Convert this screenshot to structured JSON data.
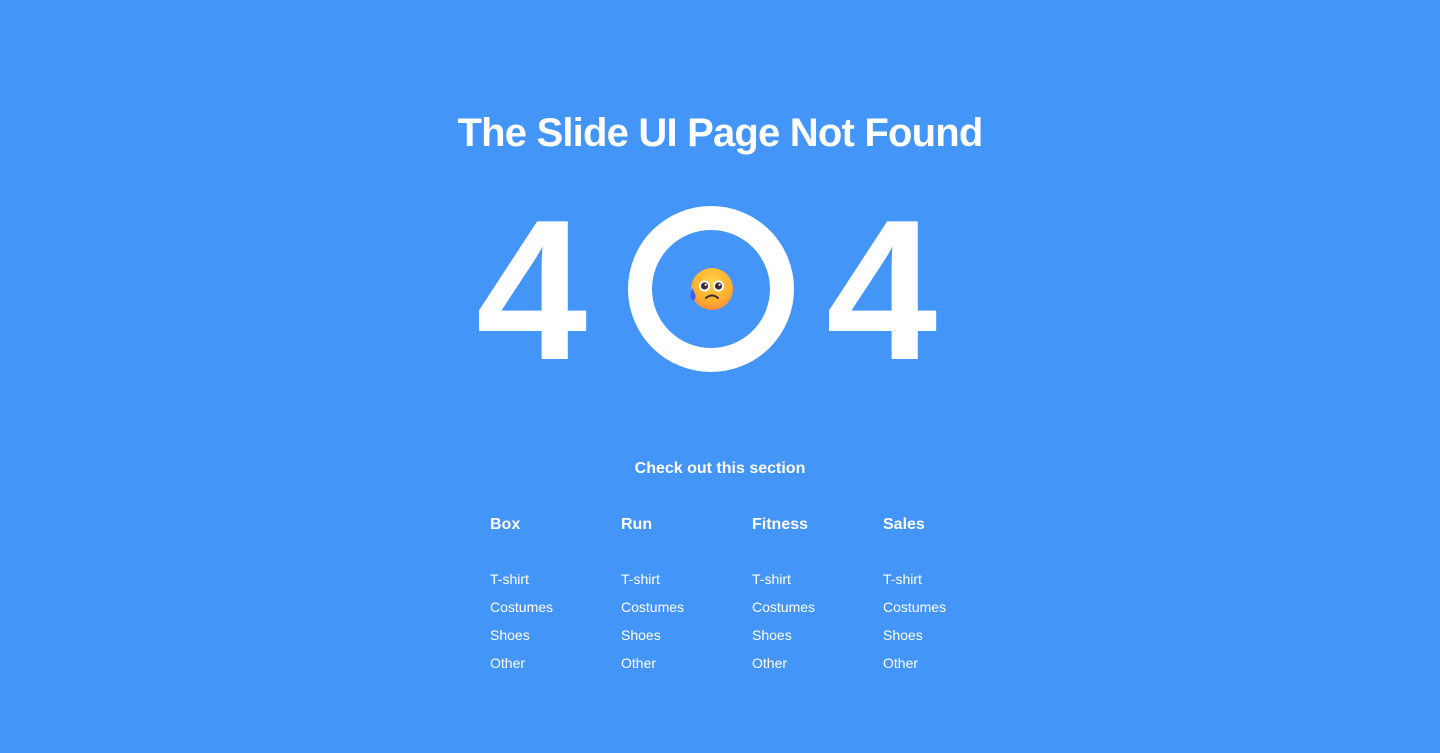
{
  "title": "The Slide UI Page Not Found",
  "error_code": {
    "first_digit": "4",
    "last_digit": "4"
  },
  "emoji": "sad-sweat-face-icon",
  "section_heading": "Check out this section",
  "categories": [
    {
      "title": "Box",
      "items": [
        "T-shirt",
        "Costumes",
        "Shoes",
        "Other"
      ]
    },
    {
      "title": "Run",
      "items": [
        "T-shirt",
        "Costumes",
        "Shoes",
        "Other"
      ]
    },
    {
      "title": "Fitness",
      "items": [
        "T-shirt",
        "Costumes",
        "Shoes",
        "Other"
      ]
    },
    {
      "title": "Sales",
      "items": [
        "T-shirt",
        "Costumes",
        "Shoes",
        "Other"
      ]
    }
  ],
  "colors": {
    "background": "#4395f8",
    "text": "#ffffff",
    "emoji_face": "#ffb02e",
    "emoji_tear": "#3f5fff"
  }
}
